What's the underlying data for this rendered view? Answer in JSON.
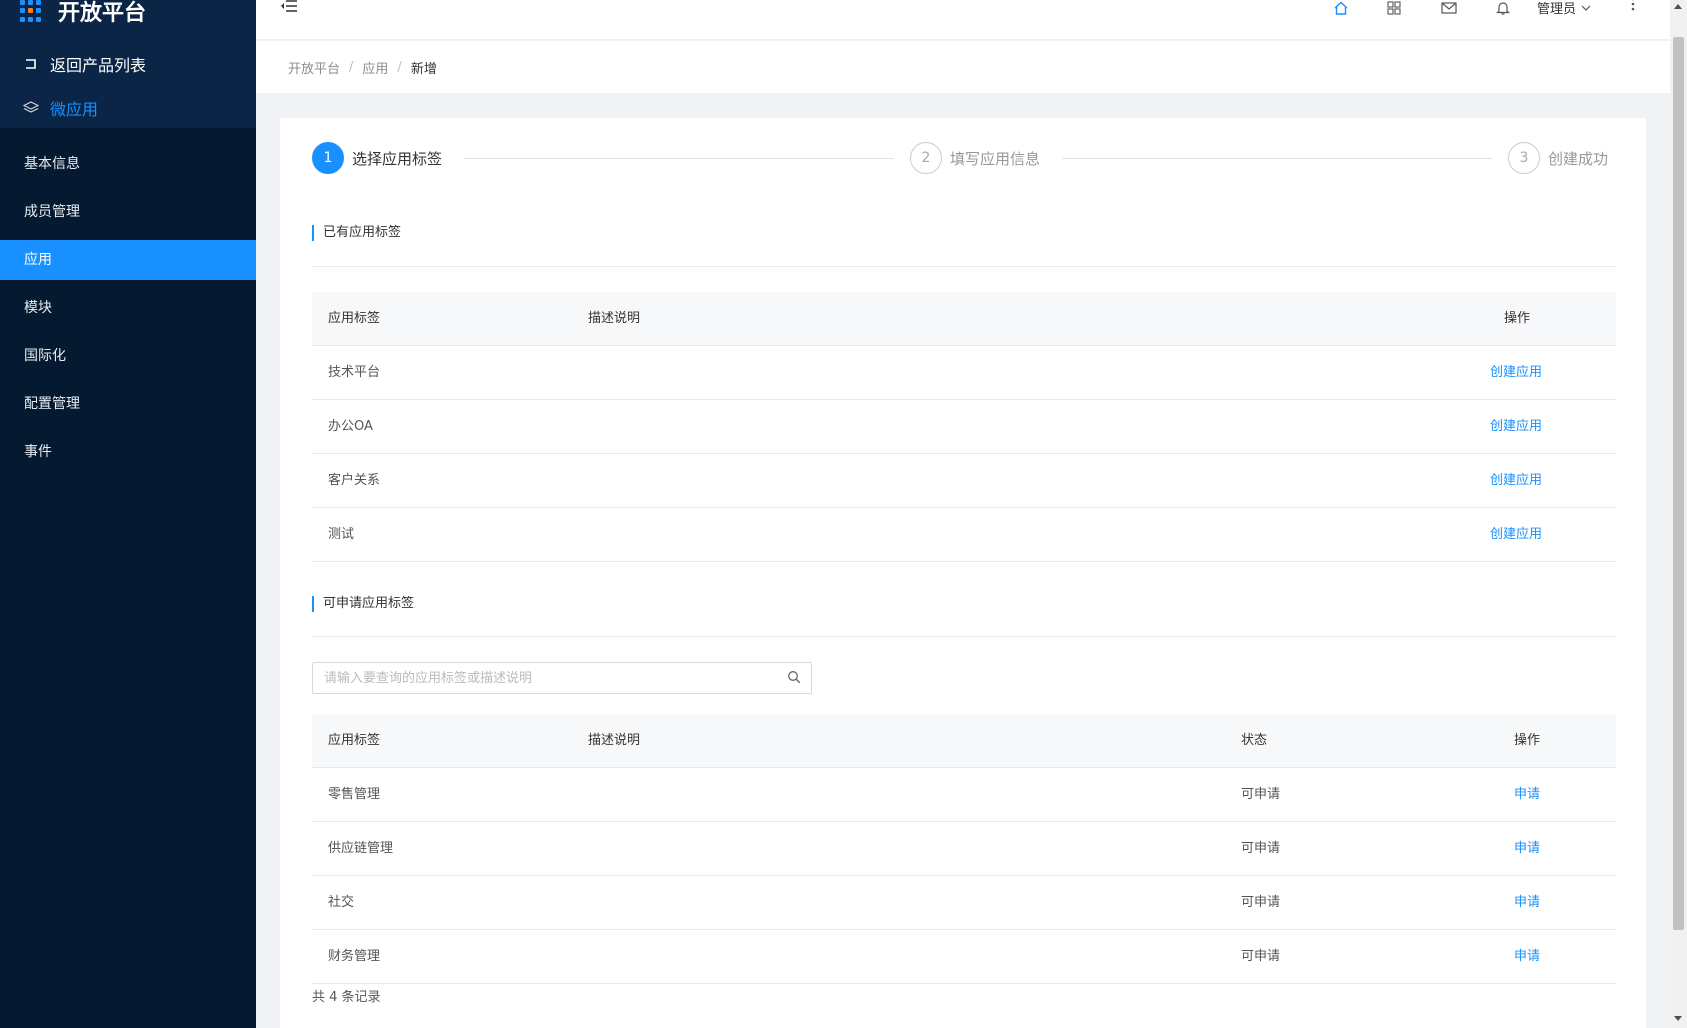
{
  "app": {
    "title": "开放平台",
    "back_label": "返回产品列表",
    "micro_app_label": "微应用"
  },
  "menu": {
    "items": [
      {
        "label": "基本信息",
        "active": false
      },
      {
        "label": "成员管理",
        "active": false
      },
      {
        "label": "应用",
        "active": true
      },
      {
        "label": "模块",
        "active": false
      },
      {
        "label": "国际化",
        "active": false
      },
      {
        "label": "配置管理",
        "active": false
      },
      {
        "label": "事件",
        "active": false
      }
    ]
  },
  "header": {
    "user_label": "管理员",
    "icons": [
      "home-icon",
      "apps-grid-icon",
      "mail-icon",
      "bell-icon",
      "more-vertical-icon"
    ]
  },
  "breadcrumb": [
    "开放平台",
    "应用",
    "新增"
  ],
  "steps": [
    {
      "num": "1",
      "label": "选择应用标签",
      "active": true
    },
    {
      "num": "2",
      "label": "填写应用信息",
      "active": false
    },
    {
      "num": "3",
      "label": "创建成功",
      "active": false
    }
  ],
  "existing": {
    "title": "已有应用标签",
    "columns": {
      "tag": "应用标签",
      "desc": "描述说明",
      "action": "操作"
    },
    "rows": [
      {
        "tag": "技术平台",
        "desc": "",
        "action": "创建应用"
      },
      {
        "tag": "办公OA",
        "desc": "",
        "action": "创建应用"
      },
      {
        "tag": "客户关系",
        "desc": "",
        "action": "创建应用"
      },
      {
        "tag": "测试",
        "desc": "",
        "action": "创建应用"
      }
    ]
  },
  "available": {
    "title": "可申请应用标签",
    "search_placeholder": "请输入要查询的应用标签或描述说明",
    "columns": {
      "tag": "应用标签",
      "desc": "描述说明",
      "status": "状态",
      "action": "操作"
    },
    "rows": [
      {
        "tag": "零售管理",
        "desc": "",
        "status": "可申请",
        "action": "申请"
      },
      {
        "tag": "供应链管理",
        "desc": "",
        "status": "可申请",
        "action": "申请"
      },
      {
        "tag": "社交",
        "desc": "",
        "status": "可申请",
        "action": "申请"
      },
      {
        "tag": "财务管理",
        "desc": "",
        "status": "可申请",
        "action": "申请"
      }
    ],
    "total_label": "共 4 条记录"
  },
  "colors": {
    "primary": "#1890ff",
    "sidebar_bg": "#051930",
    "sidebar_top_bg": "#0a2545"
  }
}
